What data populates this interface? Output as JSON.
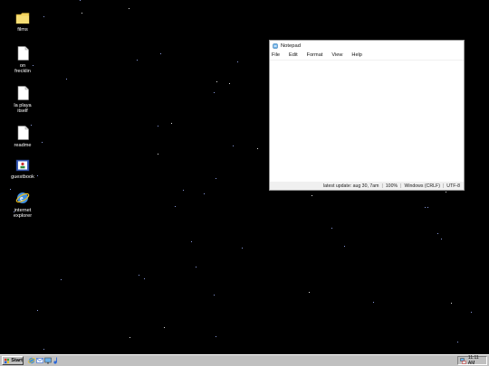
{
  "desktop": {
    "icons": [
      {
        "name": "films",
        "label": "films",
        "icon": "folder-icon"
      },
      {
        "name": "on-frecklin",
        "label": "on\nfrecklin",
        "icon": "text-file-icon"
      },
      {
        "name": "la-playa-itself",
        "label": "la playa\nitself",
        "icon": "text-file-icon"
      },
      {
        "name": "readme",
        "label": "readme",
        "icon": "text-file-icon"
      },
      {
        "name": "guestbook",
        "label": "guestbook",
        "icon": "address-book-icon"
      },
      {
        "name": "internet-explorer",
        "label": "internet\nexplorer",
        "icon": "internet-explorer-icon"
      }
    ]
  },
  "notepad": {
    "title": "Notepad",
    "menu": [
      "File",
      "Edit",
      "Format",
      "View",
      "Help"
    ],
    "content": "",
    "status": {
      "update": "latest update: aug 30, 7am",
      "zoom": "100%",
      "line_endings": "Windows (CRLF)",
      "encoding": "UTF-8"
    }
  },
  "taskbar": {
    "start_label": "Start",
    "quick_launch": [
      "internet-explorer-icon",
      "outlook-express-icon",
      "show-desktop-icon",
      "media-icon"
    ],
    "clock": "11:11 AM"
  },
  "colors": {
    "desktop": "#000000",
    "taskbar": "#c0c0c0",
    "folder": "#f2d25c",
    "star": "#9fb2ff"
  }
}
